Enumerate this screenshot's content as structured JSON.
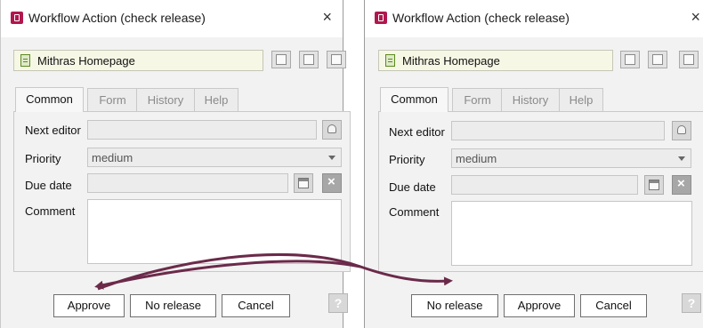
{
  "dialogs": [
    {
      "title": "Workflow Action (check release)",
      "close_glyph": "×",
      "object_name": "Mithras Homepage",
      "tabs": [
        "Common",
        "Form",
        "History",
        "Help"
      ],
      "active_tab": "Common",
      "fields": {
        "next_editor_label": "Next editor",
        "next_editor_value": "",
        "priority_label": "Priority",
        "priority_value": "medium",
        "due_date_label": "Due date",
        "due_date_value": "",
        "comment_label": "Comment",
        "comment_value": ""
      },
      "buttons": [
        "Approve",
        "No release",
        "Cancel"
      ],
      "help_glyph": "?"
    },
    {
      "title": "Workflow Action (check release)",
      "close_glyph": "×",
      "object_name": "Mithras Homepage",
      "tabs": [
        "Common",
        "Form",
        "History",
        "Help"
      ],
      "active_tab": "Common",
      "fields": {
        "next_editor_label": "Next editor",
        "next_editor_value": "",
        "priority_label": "Priority",
        "priority_value": "medium",
        "due_date_label": "Due date",
        "due_date_value": "",
        "comment_label": "Comment",
        "comment_value": ""
      },
      "buttons": [
        "No release",
        "Approve",
        "Cancel"
      ],
      "help_glyph": "?"
    }
  ],
  "icons": {
    "app": "workflow-app-icon",
    "object": "page-document-icon",
    "person": "person-select-icon",
    "calendar": "calendar-icon",
    "clear": "clear-x-icon",
    "help": "help-icon"
  },
  "annotation": {
    "arrow_color": "#6b2a4a",
    "meaning": "swap-buttons-arrow"
  },
  "colors": {
    "app_icon": "#b0174e",
    "object_icon": "#5b8a1f",
    "object_field_bg": "#f7f7e6"
  }
}
